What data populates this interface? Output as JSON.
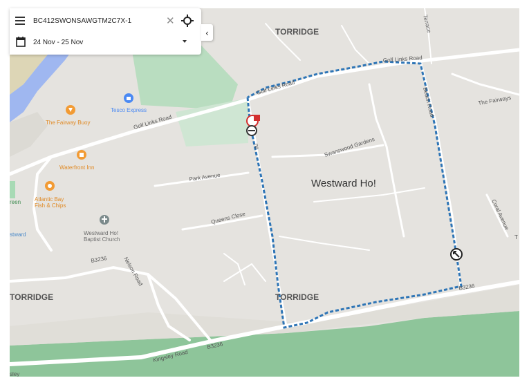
{
  "search": {
    "vehicle_id": "BC412SWONSAWGTM2C7X-1"
  },
  "date_filter": {
    "range": "24 Nov - 25 Nov"
  },
  "icons": {
    "menu": "menu-icon",
    "clear": "close-icon",
    "locate": "crosshair-icon",
    "calendar": "calendar-icon",
    "dropdown": "chevron-down-icon",
    "collapse": "chevron-left-icon"
  },
  "colors": {
    "route": "#2e75b6",
    "water": "#9fb7f0",
    "land": "#e5e3df",
    "park": "#a8dab5",
    "road": "#ffffff"
  },
  "map": {
    "labels": {
      "torridge_top": "TORRIDGE",
      "torridge_left": "TORRIDGE",
      "torridge_bottom": "TORRIDGE",
      "town": "Westward Ho!",
      "golf_links_road_1": "Golf Links Road",
      "golf_links_road_2": "Golf Links Road",
      "golf_links_road_3": "Golf Links Road",
      "beach_road": "Beach Road",
      "terrace": "Terrace",
      "the_fairways": "The Fairways",
      "coral_avenue": "Coral Avenue",
      "swanswood_gardens": "Swanswood Gardens",
      "park_avenue": "Park Avenue",
      "queens_close": "Queens Close",
      "nelson_road": "Nelson Road",
      "b3236_1": "B3236",
      "b3236_2": "B3236",
      "b3236_3": "B3236",
      "kingsley_road": "Kingsley Road",
      "lane_fragment": "ne",
      "kingsley_fragment": "sley",
      "green_fragment": "reen",
      "stward_fragment": "stward",
      "t_fragment": "T",
      "tesco": "Tesco Express",
      "fairway_buoy": "The Fairway Buoy",
      "waterfront_inn": "Waterfront Inn",
      "atlantic_bay": "Atlantic Bay",
      "fish_chips": "Fish & Chips",
      "westward_ho": "Westward Ho!",
      "baptist_church": "Baptist Church"
    }
  }
}
